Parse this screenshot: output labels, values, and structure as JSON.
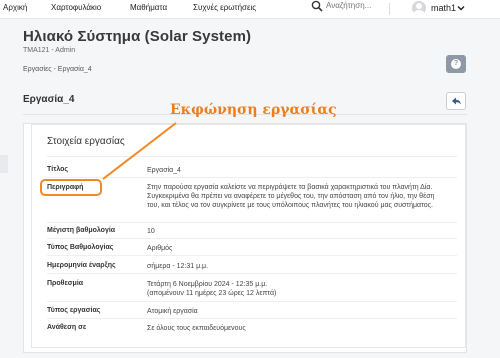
{
  "nav": {
    "items": [
      "Αρχική",
      "Χαρτοφυλάκιο",
      "Μαθήματα",
      "Συχνές ερωτήσεις"
    ],
    "search_placeholder": "Αναζήτηση...",
    "user_name": "math1"
  },
  "header": {
    "title": "Ηλιακό Σύστημα (Solar System)",
    "subtitle": "TMA121 - Admin",
    "breadcrumb": "Εργασίες - Εργασία_4"
  },
  "section": {
    "title": "Εργασία_4"
  },
  "annotation": {
    "text": "Εκφώνηση εργασίας",
    "color": "#ee7d1c"
  },
  "details": {
    "title": "Στοιχεία εργασίας",
    "rows": [
      {
        "label": "Τίτλος",
        "value": "Εργασία_4"
      },
      {
        "label": "Περιγραφή",
        "value": "Στην παρούσα εργασία καλείστε να περιγράψετε τα βασικά χαρακτηριστικά του πλανήτη Δία. Συγκεκριμένα θα πρέπει να αναφέρετε το μέγεθος του, την απόσταση από τον ήλιο, την θέση του, και τέλος να τον συγκρίνετε με τους υπόλοιπους πλανήτες του ηλιακού μας συστήματος."
      },
      {
        "label": "Μέγιστη βαθμολογία",
        "value": "10"
      },
      {
        "label": "Τύπος Βαθμολογίας",
        "value": "Αριθμός"
      },
      {
        "label": "Ημερομηνία έναρξης",
        "value": "σήμερα - 12:31 μ.μ."
      },
      {
        "label": "Προθεσμία",
        "value": "Τετάρτη 6 Νοεμβρίου 2024 - 12:35 μ.μ.",
        "value2": "(απομένουν 11 ημέρες 23 ώρες 12 λεπτά)"
      },
      {
        "label": "Τύπος εργασίας",
        "value": "Ατομική εργασία"
      },
      {
        "label": "Ανάθεση σε",
        "value": "Σε όλους τους εκπαιδευόμενους"
      }
    ]
  },
  "icons": {
    "search": "search-icon",
    "user": "user-avatar",
    "chevron": "chevron-down-icon",
    "help": "question-icon",
    "back": "reply-icon"
  }
}
